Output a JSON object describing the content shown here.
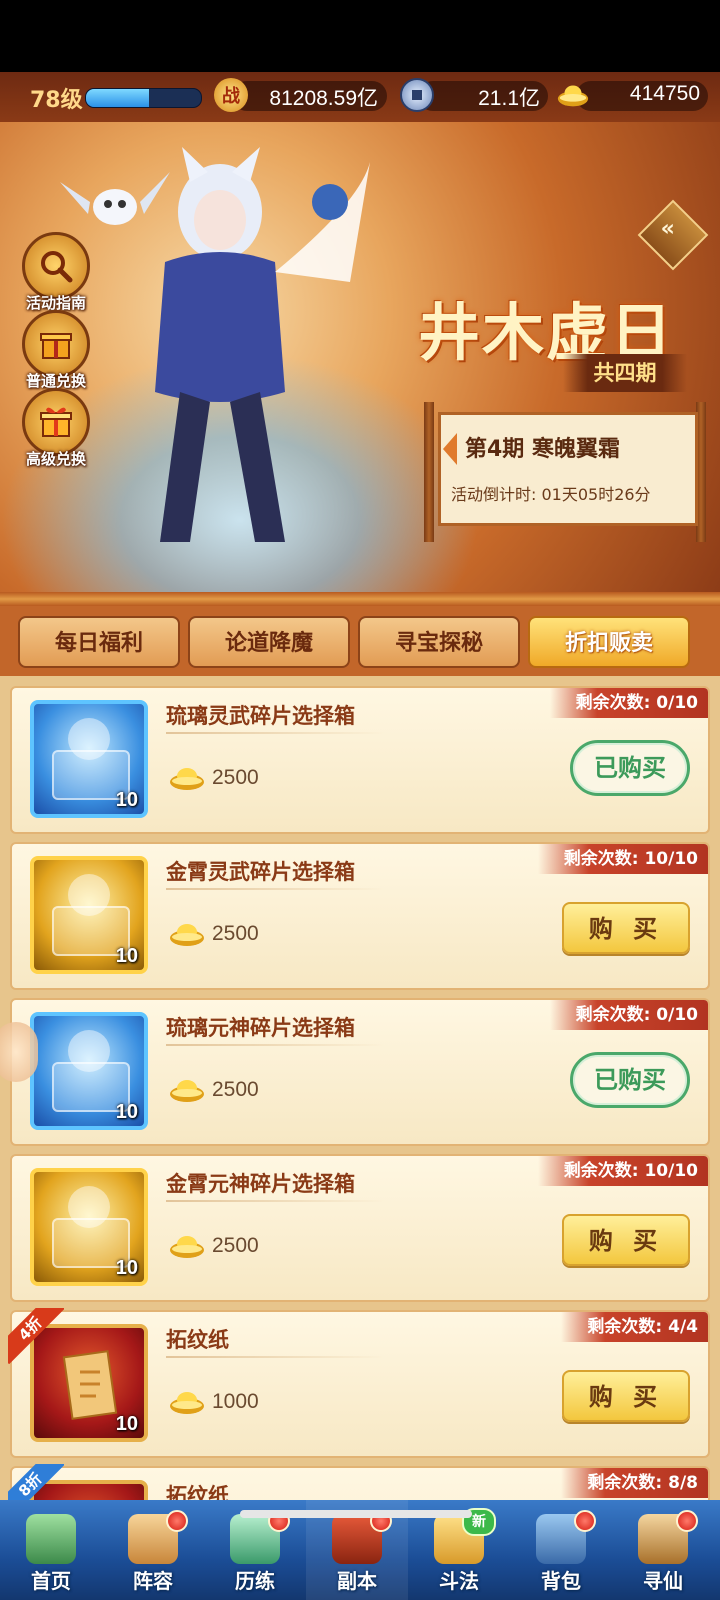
{
  "top_bar": {
    "level": "78级",
    "exp_fraction": 0.55,
    "combat_icon_char": "战",
    "combat_power": "81208.59亿",
    "silver_coin": "21.1亿",
    "gold_ingot": "414750"
  },
  "side_menu": [
    {
      "label": "活动指南",
      "icon": "magnifier-icon"
    },
    {
      "label": "普通兑换",
      "icon": "gift-icon"
    },
    {
      "label": "高级兑换",
      "icon": "gift-box-icon"
    }
  ],
  "event": {
    "title": "井木虚日",
    "period_total": "共四期",
    "phase_label": "第4期  寒魄翼霜",
    "countdown": "活动倒计时: 01天05时26分"
  },
  "tabs": [
    {
      "label": "每日福利",
      "active": false
    },
    {
      "label": "论道降魔",
      "active": false
    },
    {
      "label": "寻宝探秘",
      "active": false
    },
    {
      "label": "折扣贩卖",
      "active": true
    }
  ],
  "shop_items": [
    {
      "name": "琉璃灵武碎片选择箱",
      "price": "2500",
      "remaining": "剩余次数: 0/10",
      "count": "10",
      "status": "bought",
      "theme": "blue"
    },
    {
      "name": "金霄灵武碎片选择箱",
      "price": "2500",
      "remaining": "剩余次数: 10/10",
      "count": "10",
      "status": "buy",
      "theme": "gold"
    },
    {
      "name": "琉璃元神碎片选择箱",
      "price": "2500",
      "remaining": "剩余次数: 0/10",
      "count": "10",
      "status": "bought",
      "theme": "blue"
    },
    {
      "name": "金霄元神碎片选择箱",
      "price": "2500",
      "remaining": "剩余次数: 10/10",
      "count": "10",
      "status": "buy",
      "theme": "gold"
    },
    {
      "name": "拓纹纸",
      "price": "1000",
      "remaining": "剩余次数: 4/4",
      "count": "10",
      "status": "buy",
      "theme": "red",
      "discount": "4折"
    },
    {
      "name": "拓纹纸",
      "price": "",
      "remaining": "剩余次数: 8/8",
      "count": "",
      "status": "none",
      "theme": "red",
      "discount": "8折"
    }
  ],
  "buttons": {
    "buy": "购 买",
    "bought": "已购买"
  },
  "bottom_nav": [
    {
      "label": "首页",
      "icon": "home-icon",
      "badge": ""
    },
    {
      "label": "阵容",
      "icon": "lineup-icon",
      "badge": "dot"
    },
    {
      "label": "历练",
      "icon": "training-icon",
      "badge": "dot"
    },
    {
      "label": "副本",
      "icon": "dungeon-icon",
      "badge": "dot"
    },
    {
      "label": "斗法",
      "icon": "battle-icon",
      "badge": "新"
    },
    {
      "label": "背包",
      "icon": "bag-icon",
      "badge": "dot"
    },
    {
      "label": "寻仙",
      "icon": "seek-immortal-icon",
      "badge": "dot"
    }
  ],
  "colors": {
    "accent_gold": "#f3c73e",
    "bought_green": "#3c9a5a",
    "remaining_red": "#c8432a"
  }
}
